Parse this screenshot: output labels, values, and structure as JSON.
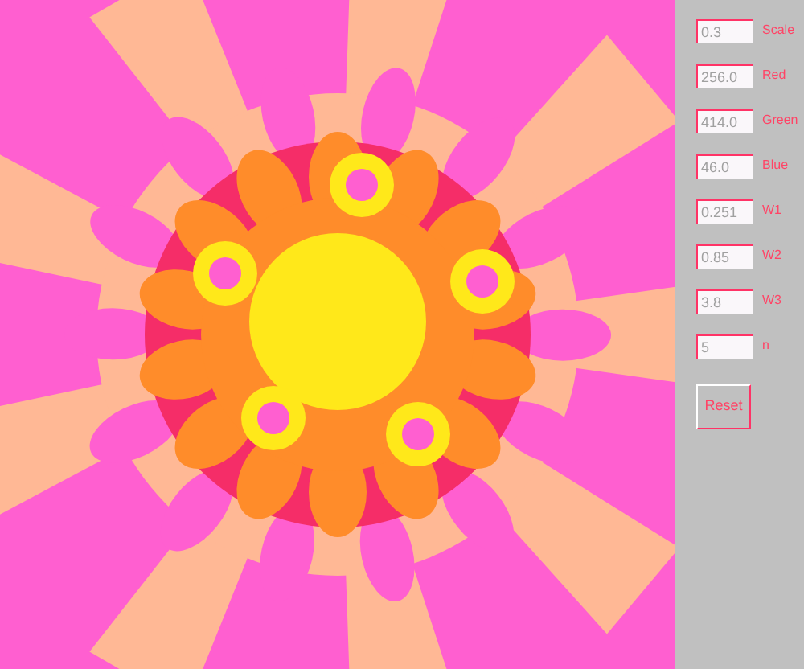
{
  "params": [
    {
      "value": "0.3",
      "label": "Scale"
    },
    {
      "value": "256.0",
      "label": "Red"
    },
    {
      "value": "414.0",
      "label": "Green"
    },
    {
      "value": "46.0",
      "label": "Blue"
    },
    {
      "value": "0.251",
      "label": "W1"
    },
    {
      "value": "0.85",
      "label": "W2"
    },
    {
      "value": "3.8",
      "label": "W3"
    },
    {
      "value": "5",
      "label": "n"
    }
  ],
  "reset_button": "Reset"
}
